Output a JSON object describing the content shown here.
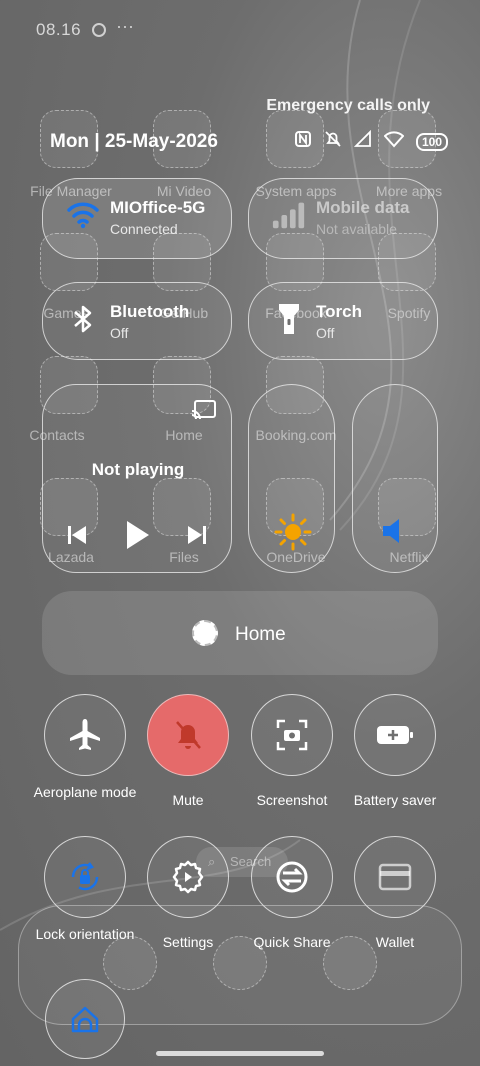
{
  "status_bar": {
    "time": "08.16",
    "more": "···",
    "emergency": "Emergency calls only",
    "battery": "100"
  },
  "date": "Mon | 25-May-2026",
  "background_apps": [
    {
      "label": "File Manager"
    },
    {
      "label": "Mi Video"
    },
    {
      "label": "System apps"
    },
    {
      "label": "More apps"
    },
    {
      "label": "Games"
    },
    {
      "label": "GetHub"
    },
    {
      "label": "Facebook"
    },
    {
      "label": "Spotify"
    },
    {
      "label": "Contacts"
    },
    {
      "label": "Home"
    },
    {
      "label": "Booking.com"
    },
    {
      "label": "Lazada"
    },
    {
      "label": "Files"
    },
    {
      "label": "OneDrive"
    },
    {
      "label": "Netflix"
    }
  ],
  "wifi": {
    "title": "MIOffice-5G",
    "status": "Connected"
  },
  "mobile_data": {
    "title": "Mobile data",
    "status": "Not available"
  },
  "bluetooth": {
    "title": "Bluetooth",
    "status": "Off"
  },
  "torch": {
    "title": "Torch",
    "status": "Off"
  },
  "media": {
    "status": "Not playing"
  },
  "home_device": {
    "label": "Home"
  },
  "tiles": [
    {
      "label": "Aeroplane mode",
      "icon": "airplane-icon"
    },
    {
      "label": "Mute",
      "icon": "bell-off-icon"
    },
    {
      "label": "Screenshot",
      "icon": "screenshot-icon"
    },
    {
      "label": "Battery saver",
      "icon": "battery-plus-icon"
    },
    {
      "label": "Lock orientation",
      "icon": "rotation-lock-icon"
    },
    {
      "label": "Settings",
      "icon": "gear-icon"
    },
    {
      "label": "Quick Share",
      "icon": "quick-share-icon"
    },
    {
      "label": "Wallet",
      "icon": "wallet-icon"
    }
  ],
  "search": {
    "label": "Search"
  },
  "colors": {
    "accent_blue": "#1a73e8",
    "mute_red": "#e56a6a",
    "sun_orange": "#f4a300"
  }
}
